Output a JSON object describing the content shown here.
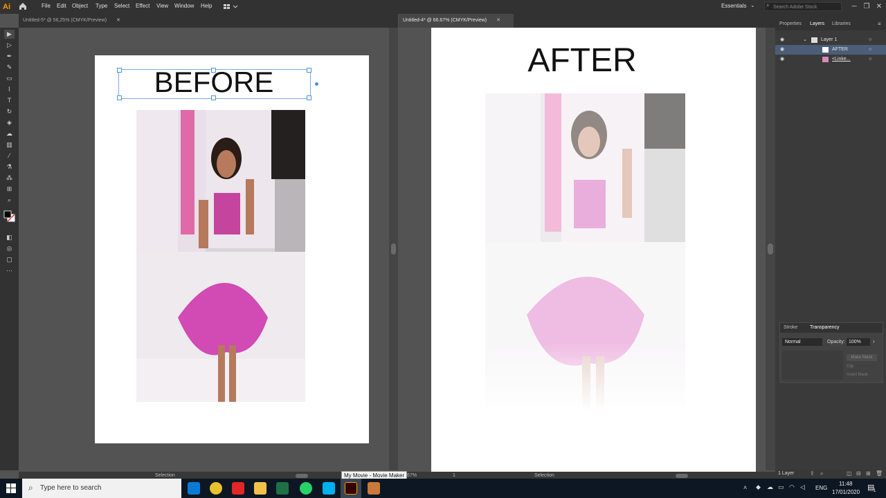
{
  "app": {
    "logo_text": "Ai"
  },
  "menu": [
    "File",
    "Edit",
    "Object",
    "Type",
    "Select",
    "Effect",
    "View",
    "Window",
    "Help"
  ],
  "workspace": "Essentials",
  "stock_search": {
    "placeholder": "Search Adobe Stock"
  },
  "window_controls": [
    "─",
    "❐",
    "✕"
  ],
  "doc_left": {
    "tab_title": "Untitled-5* @ 56,25% (CMYK/Preview)",
    "heading": "BEFORE",
    "status_tool": "Selection"
  },
  "doc_right": {
    "tab_title": "Untitled-4* @ 66.67% (CMYK/Preview)",
    "heading": "AFTER",
    "zoom": "67%",
    "artboard_num": "1",
    "status_tool": "Selection"
  },
  "right_panel": {
    "tabs": [
      "Properties",
      "Layers",
      "Libraries"
    ],
    "active_tab": "Layers",
    "layers": [
      {
        "name": "Layer 1"
      },
      {
        "name": "AFTER"
      },
      {
        "name": "<Linke..."
      }
    ],
    "layers_count": "1 Layer",
    "bottom_tabs": [
      "Stroke",
      "Transparency"
    ],
    "blend_mode": "Normal",
    "opacity_label": "Opacity:",
    "opacity_value": "100%",
    "make_mask": "Make Mask",
    "clip": "Clip",
    "invert_mask": "Invert Mask"
  },
  "tooltip": "My Movie - Movie Maker",
  "taskbar": {
    "search_placeholder": "Type here to search",
    "lang": "ENG",
    "time": "11:48",
    "date": "17/01/2020",
    "notif_count": "1",
    "apps": [
      "edge",
      "chrome",
      "youtube",
      "file-explorer",
      "excel",
      "whatsapp",
      "skype",
      "illustrator",
      "movie-maker"
    ]
  },
  "colors": {
    "accent": "#4a90d9",
    "ai_orange": "#ff9a00"
  }
}
